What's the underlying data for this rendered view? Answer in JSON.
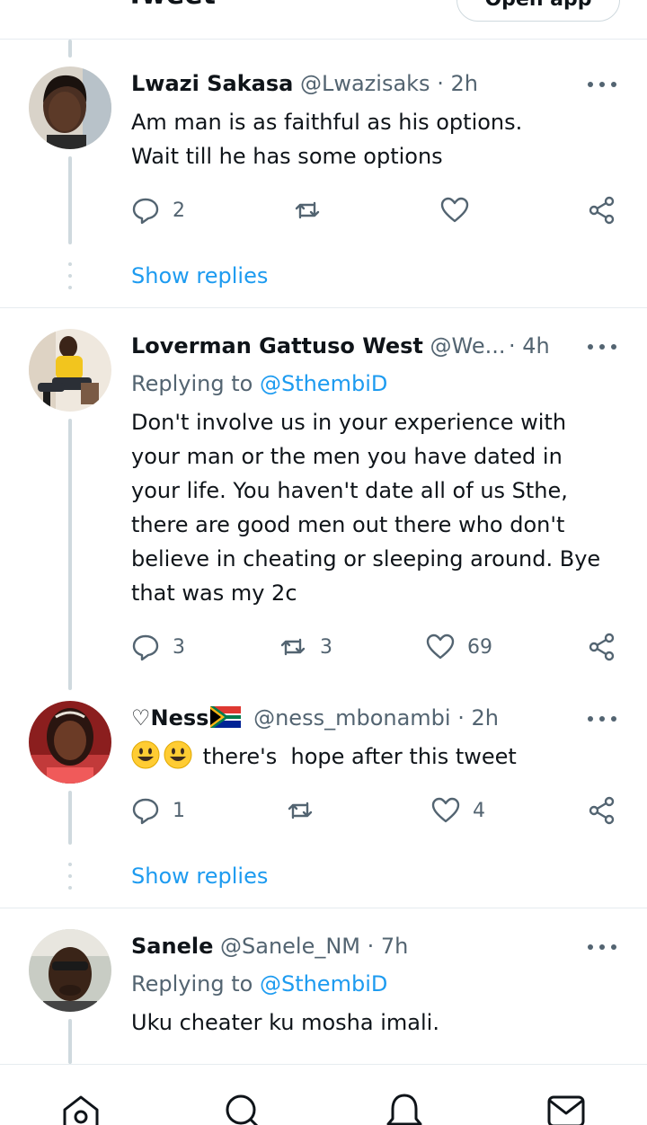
{
  "header": {
    "title": "Tweet",
    "open_app_label": "Open app"
  },
  "colors": {
    "accent": "#1d9bf0",
    "muted": "#536471",
    "text": "#0f1419",
    "thread": "#cfd9de"
  },
  "replies": [
    {
      "name": "Lwazi Sakasa",
      "handle": "@Lwazisaks",
      "time": "· 2h",
      "text_lines": [
        "Am man is as faithful as his options.",
        "Wait till he has some options"
      ],
      "replies_count": "2",
      "retweets_count": "",
      "likes_count": "",
      "show_replies": "Show replies"
    },
    {
      "name": "Loverman Gattuso West",
      "handle": "@We...",
      "time": "· 4h",
      "replying_prefix": "Replying to",
      "replying_to": "@SthembiD",
      "text_lines": [
        "Don't involve us in your experience with",
        "your man or the men you have dated in",
        "your life. You haven't date all of us Sthe,",
        "there are good men out there who don't",
        "believe in cheating or sleeping around. Bye",
        "that was my 2c"
      ],
      "replies_count": "3",
      "retweets_count": "3",
      "likes_count": "69"
    },
    {
      "name": "♡Ness",
      "handle": "@ness_mbonambi",
      "time": "· 2h",
      "flag_icon": "south-africa-flag-icon",
      "emoji_icons": [
        "grinning-face-icon",
        "grinning-face-icon"
      ],
      "text": "there's  hope after this tweet",
      "replies_count": "1",
      "retweets_count": "",
      "likes_count": "4",
      "show_replies": "Show replies"
    },
    {
      "name": "Sanele",
      "handle": "@Sanele_NM",
      "time": "· 7h",
      "replying_prefix": "Replying to",
      "replying_to": "@SthembiD",
      "text_lines": [
        "Uku cheater ku mosha imali."
      ]
    }
  ],
  "bottom_nav": [
    "home-icon",
    "search-icon",
    "notifications-icon",
    "messages-icon"
  ]
}
